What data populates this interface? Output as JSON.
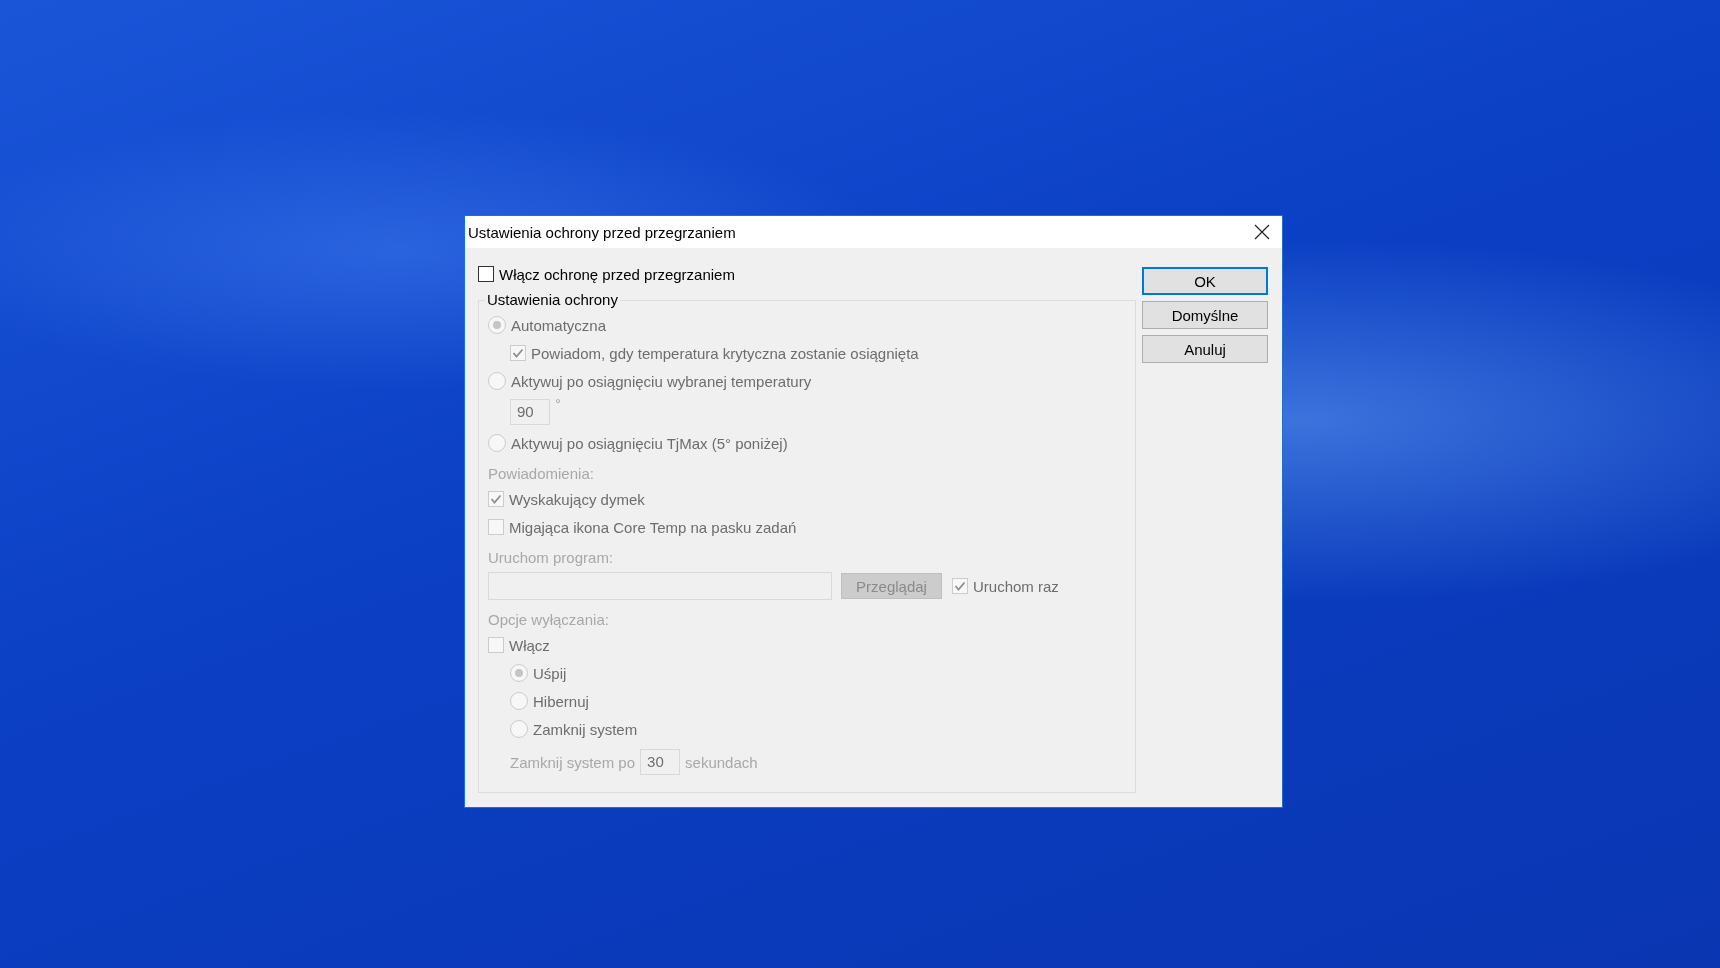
{
  "window": {
    "title": "Ustawienia ochrony przed przegrzaniem"
  },
  "enable": {
    "label": "Włącz ochronę przed przegrzaniem",
    "checked": false
  },
  "group": {
    "title": "Ustawienia ochrony",
    "items": [
      {
        "kind": "radio",
        "label": "Automatyczna",
        "selected": true,
        "disabled": true,
        "children": [
          {
            "kind": "checkbox",
            "label": "Powiadom, gdy temperatura krytyczna zostanie osiągnięta",
            "checked": true,
            "disabled": true
          }
        ]
      },
      {
        "kind": "radio",
        "label": "Aktywuj po osiągnięciu wybranej temperatury",
        "selected": false,
        "disabled": true,
        "children": [
          {
            "kind": "number",
            "value": "90",
            "unit": "°",
            "disabled": true
          }
        ]
      },
      {
        "kind": "radio",
        "label": "Aktywuj po osiągnięciu TjMax (5° poniżej)",
        "selected": false,
        "disabled": true
      },
      {
        "kind": "heading",
        "label": "Powiadomienia:",
        "disabled": true
      },
      {
        "kind": "checkbox",
        "label": "Wyskakujący dymek",
        "checked": true,
        "disabled": true
      },
      {
        "kind": "checkbox",
        "label": "Migająca ikona Core Temp na pasku zadań",
        "checked": false,
        "disabled": true
      },
      {
        "kind": "heading",
        "label": "Uruchom program:",
        "disabled": true
      },
      {
        "kind": "program",
        "button": "Przeglądaj",
        "run_once": {
          "label": "Uruchom raz",
          "checked": true
        },
        "disabled": true
      },
      {
        "kind": "heading",
        "label": "Opcje wyłączania:",
        "disabled": true
      },
      {
        "kind": "checkbox",
        "label": "Włącz",
        "checked": false,
        "disabled": true,
        "children": [
          {
            "kind": "radio",
            "label": "Uśpij",
            "selected": true,
            "disabled": true
          },
          {
            "kind": "radio",
            "label": "Hibernuj",
            "selected": false,
            "disabled": true
          },
          {
            "kind": "radio",
            "label": "Zamknij system",
            "selected": false,
            "disabled": true
          },
          {
            "kind": "delay",
            "before": "Zamknij system po",
            "value": "30",
            "after": "sekundach",
            "disabled": true
          }
        ]
      }
    ]
  },
  "buttons": [
    {
      "label": "OK",
      "default": true
    },
    {
      "label": "Domyślne",
      "default": false
    },
    {
      "label": "Anuluj",
      "default": false
    }
  ]
}
